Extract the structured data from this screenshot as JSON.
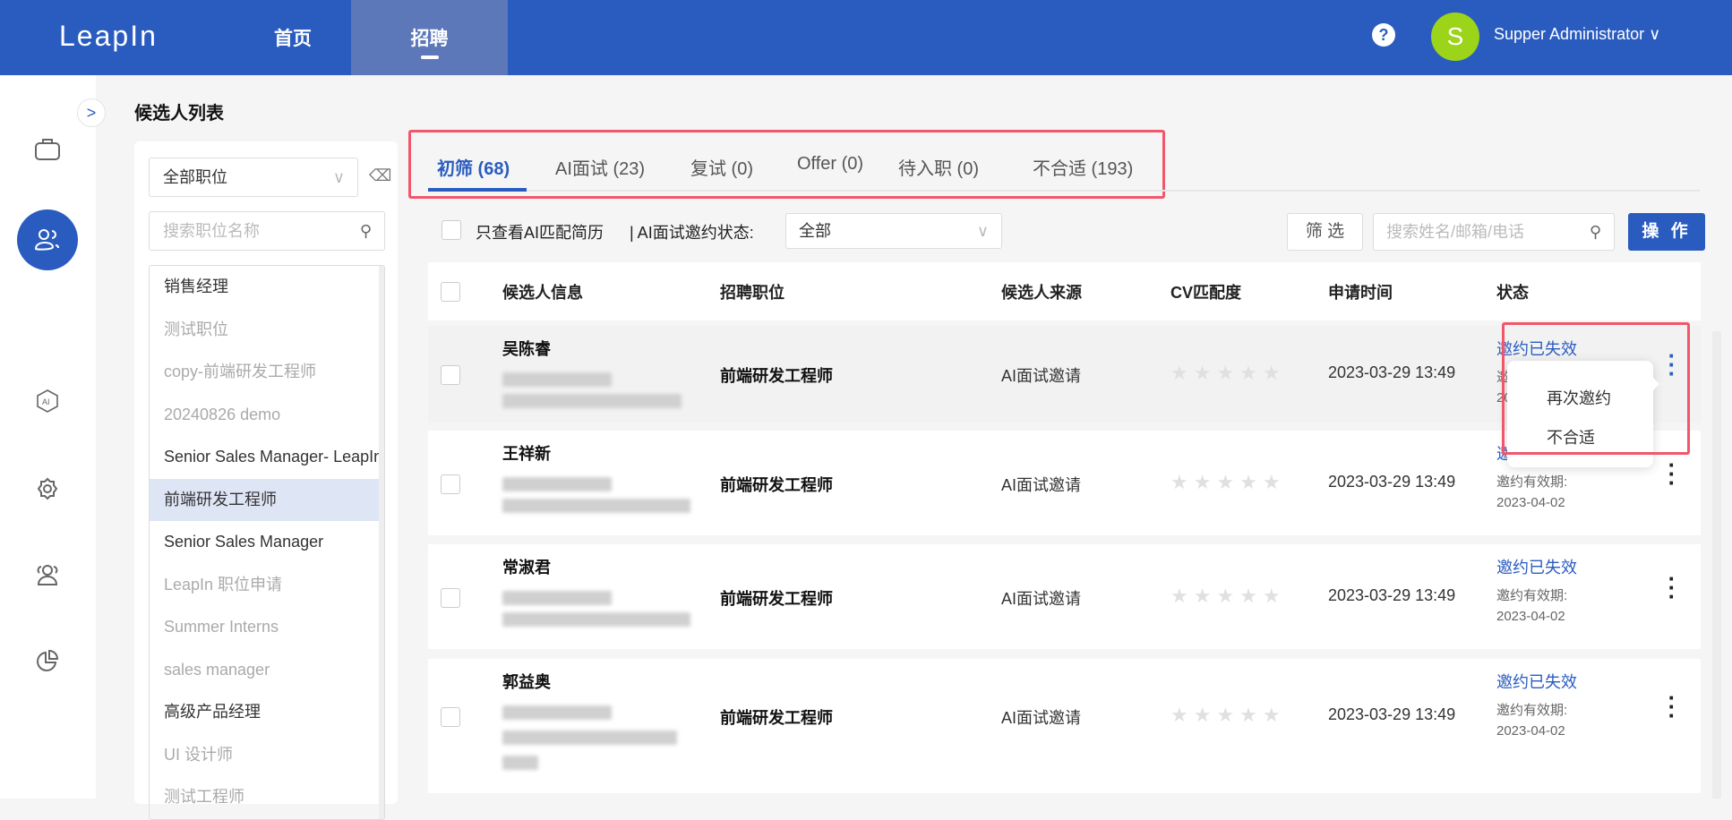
{
  "header": {
    "logo": "LeapIn",
    "nav": [
      {
        "label": "首页"
      },
      {
        "label": "招聘"
      }
    ],
    "help": "?",
    "avatar_letter": "S",
    "user": "Supper Administrator ∨"
  },
  "sidebar": {
    "icons": [
      "briefcase-icon",
      "candidates-icon",
      "ai-icon",
      "gear-icon",
      "team-icon",
      "pie-chart-icon"
    ],
    "expand": ">"
  },
  "page_title": "候选人列表",
  "jobs": {
    "select_value": "全部职位",
    "search_placeholder": "搜索职位名称",
    "items": [
      {
        "label": "销售经理",
        "state": "active"
      },
      {
        "label": "测试职位",
        "state": "dim"
      },
      {
        "label": "copy-前端研发工程师",
        "state": "dim"
      },
      {
        "label": "20240826 demo",
        "state": "dim"
      },
      {
        "label": "Senior Sales Manager- LeapIn",
        "state": "active"
      },
      {
        "label": "前端研发工程师",
        "state": "selected"
      },
      {
        "label": "Senior Sales Manager",
        "state": "active"
      },
      {
        "label": "LeapIn 职位申请",
        "state": "dim"
      },
      {
        "label": "Summer Interns",
        "state": "dim"
      },
      {
        "label": "sales manager",
        "state": "dim"
      },
      {
        "label": "高级产品经理",
        "state": "active"
      },
      {
        "label": "UI 设计师",
        "state": "dim"
      },
      {
        "label": "测试工程师",
        "state": "dim"
      }
    ]
  },
  "tabs": [
    {
      "label": "初筛 (68)"
    },
    {
      "label": "AI面试 (23)"
    },
    {
      "label": "复试 (0)"
    },
    {
      "label": "Offer (0)"
    },
    {
      "label": "待入职 (0)"
    },
    {
      "label": "不合适 (193)"
    }
  ],
  "filters": {
    "ai_only": "只查看AI匹配简历",
    "status_label": "| AI面试邀约状态:",
    "status_value": "全部",
    "filter_btn": "筛 选",
    "search_placeholder": "搜索姓名/邮箱/电话",
    "action_btn": "操 作"
  },
  "table": {
    "headers": [
      "候选人信息",
      "招聘职位",
      "候选人来源",
      "CV匹配度",
      "申请时间",
      "状态"
    ],
    "rows": [
      {
        "name": "吴陈睿",
        "job": "前端研发工程师",
        "source": "AI面试邀请",
        "stars": "★★★★★",
        "time": "2023-03-29 13:49",
        "status": "邀约已失效",
        "exp_label": "邀约有效期:",
        "exp_date": "2023-04-02"
      },
      {
        "name": "王祥新",
        "job": "前端研发工程师",
        "source": "AI面试邀请",
        "stars": "★★★★★",
        "time": "2023-03-29 13:49",
        "status": "邀约已失效",
        "exp_label": "邀约有效期:",
        "exp_date": "2023-04-02"
      },
      {
        "name": "常淑君",
        "job": "前端研发工程师",
        "source": "AI面试邀请",
        "stars": "★★★★★",
        "time": "2023-03-29 13:49",
        "status": "邀约已失效",
        "exp_label": "邀约有效期:",
        "exp_date": "2023-04-02"
      },
      {
        "name": "郭益奥",
        "job": "前端研发工程师",
        "source": "AI面试邀请",
        "stars": "★★★★★",
        "time": "2023-03-29 13:49",
        "status": "邀约已失效",
        "exp_label": "邀约有效期:",
        "exp_date": "2023-04-02"
      }
    ]
  },
  "row_menu": {
    "items": [
      "再次邀约",
      "不合适"
    ]
  },
  "colors": {
    "brand": "#2a5cc0",
    "highlight": "#f2566b",
    "avatar": "#9cd41a"
  }
}
